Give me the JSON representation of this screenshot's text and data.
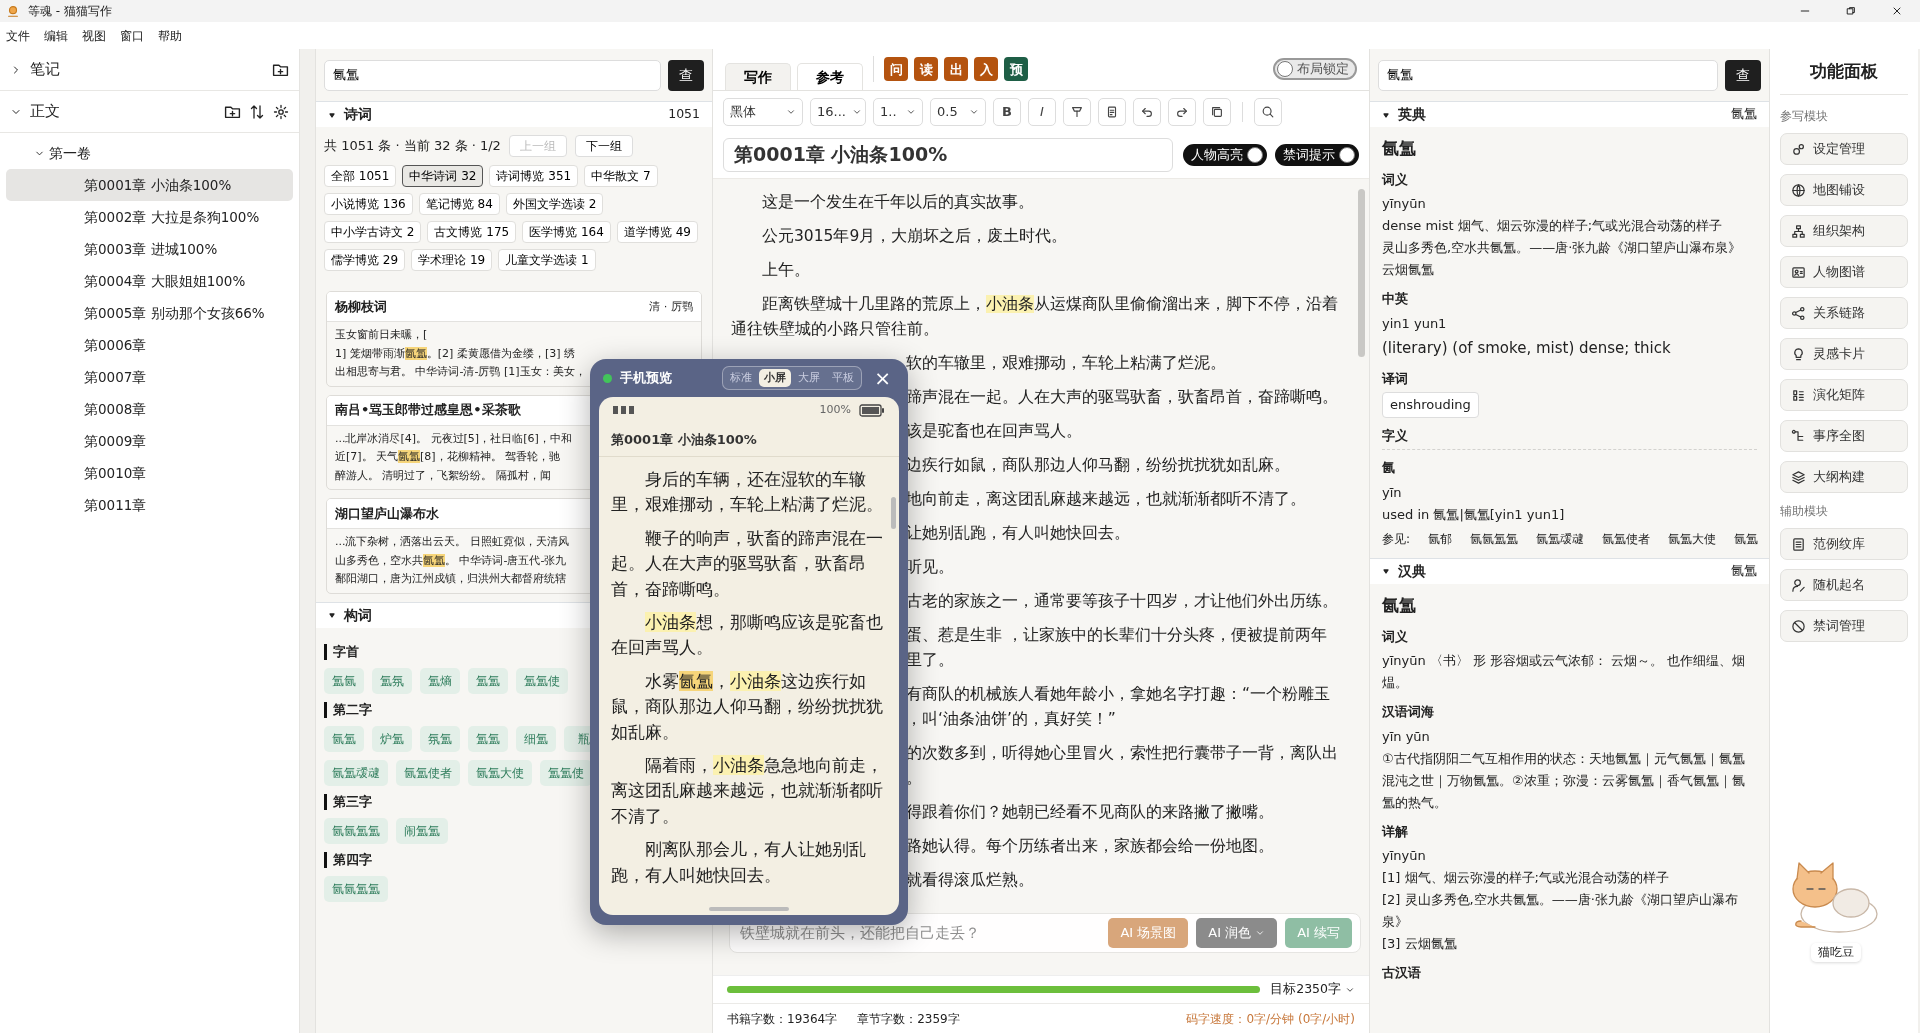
{
  "window": {
    "title": "等魂 - 猫猫写作"
  },
  "menu": [
    "文件",
    "编辑",
    "视图",
    "窗口",
    "帮助"
  ],
  "sidebar": {
    "sections": [
      {
        "label": "笔记",
        "expanded": false
      },
      {
        "label": "正文",
        "expanded": true,
        "children": [
          {
            "label": "第一卷",
            "expanded": true,
            "children": [
              {
                "label": "第0001章 小油条100%",
                "selected": true
              },
              {
                "label": "第0002章 大拉是条狗100%",
                "selected": false
              },
              {
                "label": "第0003章 进城100%",
                "selected": false
              },
              {
                "label": "第0004章 大眼姐姐100%",
                "selected": false
              },
              {
                "label": "第0005章 别动那个女孩66%",
                "selected": false
              },
              {
                "label": "第0006章",
                "selected": false
              },
              {
                "label": "第0007章",
                "selected": false
              },
              {
                "label": "第0008章",
                "selected": false
              },
              {
                "label": "第0009章",
                "selected": false
              },
              {
                "label": "第0010章",
                "selected": false
              },
              {
                "label": "第0011章",
                "selected": false
              }
            ]
          }
        ]
      }
    ]
  },
  "reference": {
    "search": {
      "value": "氤氲",
      "button": "查"
    },
    "poems": {
      "title": "诗词",
      "count": "1051",
      "expanded": true,
      "summary": "共 1051 条 · 当前 32 条 · 1/2",
      "pager": [
        {
          "label": "上一组",
          "disabled": true
        },
        {
          "label": "下一组",
          "disabled": false
        }
      ],
      "filters": [
        {
          "label": "全部 1051",
          "selected": false
        },
        {
          "label": "中华诗词 32",
          "selected": true
        },
        {
          "label": "诗词博览 351",
          "selected": false
        },
        {
          "label": "中华散文 7",
          "selected": false
        },
        {
          "label": "小说博览 136",
          "selected": false
        },
        {
          "label": "笔记博览 84",
          "selected": false
        },
        {
          "label": "外国文学选读 2",
          "selected": false
        },
        {
          "label": "中小学古诗文 2",
          "selected": false
        },
        {
          "label": "古文博览 175",
          "selected": false
        },
        {
          "label": "医学博览 164",
          "selected": false
        },
        {
          "label": "道学博览 49",
          "selected": false
        },
        {
          "label": "儒学博览 29",
          "selected": false
        },
        {
          "label": "学术理论 19",
          "selected": false
        },
        {
          "label": "儿童文学选读 1",
          "selected": false
        }
      ],
      "cards": [
        {
          "title": "杨柳枝词",
          "author": "清 · 厉鹗",
          "lines": [
            "玉女窗前日未曛，[",
            [
              {
                "text": "1] 笼烟带雨渐"
              },
              {
                "text": "氤氲",
                "kind": "term"
              },
              {
                "text": "。[2] 柔黄愿借为金缕，[3] 绣"
              }
            ],
            "出相思寄与君。 中华诗词-清-厉鹗 [1]玉女：美女，"
          ]
        },
        {
          "title": "南吕•骂玉郎带过感皇恩•采茶歌",
          "lines": [
            "...北岸冰消尽[4]。 元夜过[5]，社日临[6]，中和",
            [
              {
                "text": "近[7]。 天气"
              },
              {
                "text": "氤氲",
                "kind": "term"
              },
              {
                "text": "[8]，花柳精神。 驾香轮，驰"
              }
            ],
            "醉游人。 清明过了，飞絮纷纷。 隔孤村，闻"
          ]
        },
        {
          "title": "湖口望庐山瀑布水",
          "lines": [
            "...流下杂树，洒落出云天。 日照虹霓似，天清风",
            [
              {
                "text": "山多秀色，空水共"
              },
              {
                "text": "氤氲",
                "kind": "term"
              },
              {
                "text": "。 中华诗词-唐五代-张九"
              }
            ],
            "鄱阳湖口，唐为江州戍镇，归洪州大都督府统辖"
          ]
        }
      ]
    },
    "words": {
      "title": "构词",
      "expanded": true,
      "groups": [
        {
          "label": "字首",
          "chips": [
            "氲氤",
            "氲氛",
            "氲熵",
            "氲氲",
            "氲氲使"
          ]
        },
        {
          "label": "第二字",
          "chips": [
            "氤氲",
            "炉氲",
            "氛氲",
            "氲氲",
            "细氲",
            "瓶",
            "氤氲叆叇",
            "氤氲使者",
            "氤氲大使",
            "氲氲使"
          ]
        },
        {
          "label": "第三字",
          "chips": [
            "氤氤氲氲",
            "闹氲氲"
          ]
        },
        {
          "label": "第四字",
          "chips": [
            "氤氤氲氲"
          ]
        }
      ]
    }
  },
  "editor": {
    "tabs": [
      {
        "label": "写作",
        "selected": true
      },
      {
        "label": "参考",
        "selected": false
      }
    ],
    "actions": [
      {
        "label": "问",
        "color": "#b4530f"
      },
      {
        "label": "读",
        "color": "#b4530f"
      },
      {
        "label": "出",
        "color": "#b4530f"
      },
      {
        "label": "入",
        "color": "#b4530f"
      },
      {
        "label": "预",
        "color": "#1e5e46"
      }
    ],
    "layout_lock": {
      "label": "布局锁定",
      "on": false
    },
    "selects": [
      "黑体",
      "16...",
      "1..",
      "0.5"
    ],
    "format_buttons": [
      "B",
      "I"
    ],
    "title": "第0001章 小油条100%",
    "toggles": [
      {
        "label": "人物高亮",
        "on": true
      },
      {
        "label": "禁词提示",
        "on": true
      }
    ],
    "body": [
      {
        "kind": "para",
        "text": "这是一个发生在千年以后的真实故事。"
      },
      {
        "kind": "para",
        "text": "公元3015年9月，大崩坏之后，废土时代。"
      },
      {
        "kind": "para",
        "text": "上午。"
      },
      {
        "kind": "para",
        "text": [
          {
            "text": "距离铁壁城十几里路的荒原上，"
          },
          {
            "text": "小油条",
            "kind": "character"
          },
          {
            "text": "从运煤商队里偷偷溜出来，脚下不停，沿着通往铁壁城的小路只管往前。"
          }
        ]
      },
      {
        "kind": "clip",
        "lines": [
          "软的车辙里，艰难挪动，车轮上粘满了烂泥。"
        ]
      },
      {
        "kind": "clip",
        "lines": [
          "蹄声混在一起。人在大声的驱骂驮畜，驮畜昂首，奋蹄嘶鸣。"
        ]
      },
      {
        "kind": "clip",
        "lines": [
          "该是驼畜也在回声骂人。"
        ]
      },
      {
        "kind": "clip",
        "lines": [
          "边疾行如鼠，商队那边人仰马翻，纷纷扰扰犹如乱麻。"
        ]
      },
      {
        "kind": "clip",
        "lines": [
          "地向前走，离这团乱麻越来越远，也就渐渐都听不清了。"
        ]
      },
      {
        "kind": "clip",
        "lines": [
          "让她别乱跑，有人叫她快回去。"
        ]
      },
      {
        "kind": "clip",
        "lines": [
          "听见。"
        ]
      },
      {
        "kind": "clip",
        "lines": [
          "古老的家族之一，通常要等孩子十四岁，才让他们外出历练。"
        ]
      },
      {
        "kind": "clip",
        "lines": [
          "蛋、惹是生非 ，让家族中的长辈们十分头疼，便被提前两年",
          "里了。"
        ]
      },
      {
        "kind": "clip",
        "lines": [
          "有商队的机械族人看她年龄小，拿她名字打趣：“一个粉雕玉",
          "，叫‘油条油饼’的，真好笑！”"
        ]
      },
      {
        "kind": "clip",
        "lines": [
          "的次数多到，听得她心里冒火，索性把行囊带子一背，离队出",
          "。"
        ]
      },
      {
        "kind": "clip",
        "lines": [
          "得跟着你们？她朝已经看不见商队的来路撇了撇嘴。"
        ]
      },
      {
        "kind": "clip",
        "lines": [
          "路她认得。每个历练者出来，家族都会给一份地图。"
        ]
      },
      {
        "kind": "clip",
        "lines": [
          "就看得滚瓜烂熟。"
        ]
      }
    ],
    "ai_bar": {
      "placeholder": "铁壁城就在前头，还能把自己走丢？",
      "buttons": [
        {
          "label": "AI 场景图",
          "color": "#d8a67b",
          "dropdown": false
        },
        {
          "label": "AI 润色",
          "color": "#8b8b8b",
          "dropdown": true
        },
        {
          "label": "AI 续写",
          "color": "#8fbea4",
          "dropdown": false
        }
      ]
    },
    "progress": {
      "level": 1,
      "target": "目标2350字"
    },
    "status": {
      "book": "书籍字数：19364字",
      "chapter": "章节字数：2359字",
      "speed": "码字速度：0字/分钟 (0字/小时)"
    }
  },
  "phone_preview": {
    "title": "手机预览",
    "modes": [
      {
        "label": "标准",
        "selected": false
      },
      {
        "label": "小屏",
        "selected": true
      },
      {
        "label": "大屏",
        "selected": false
      },
      {
        "label": "平板",
        "selected": false
      }
    ],
    "close": "×",
    "battery": "100%",
    "chapter": "第0001章 小油条100%",
    "paragraphs": [
      "身后的车辆，还在湿软的车辙里，艰难挪动，车轮上粘满了烂泥。",
      "鞭子的响声，驮畜的蹄声混在一起。人在大声的驱骂驮畜，驮畜昂首，奋蹄嘶鸣。",
      [
        {
          "text": "小油条",
          "kind": "character"
        },
        {
          "text": "想，那嘶鸣应该是驼畜也在回声骂人。"
        }
      ],
      [
        {
          "text": "水雾"
        },
        {
          "text": "氤氲",
          "kind": "term"
        },
        {
          "text": "，"
        },
        {
          "text": "小油条",
          "kind": "character"
        },
        {
          "text": "这边疾行如鼠，商队那边人仰马翻，纷纷扰扰犹如乱麻。"
        }
      ],
      [
        {
          "text": "隔着雨，"
        },
        {
          "text": "小油条",
          "kind": "character"
        },
        {
          "text": "急急地向前走，离这团乱麻越来越远，也就渐渐都听不清了。"
        }
      ],
      "刚离队那会儿，有人让她别乱跑，有人叫她快回去。"
    ]
  },
  "dictionary": {
    "search": {
      "value": "氤氲",
      "button": "查"
    },
    "sections": [
      {
        "title": "英典",
        "word": "氤氲",
        "expanded": true,
        "entries": [
          {
            "kind": "word",
            "text": "氤氲"
          },
          {
            "kind": "label",
            "text": "词义"
          },
          {
            "kind": "text",
            "text": "yīnyūn"
          },
          {
            "kind": "text",
            "text": "dense mist 烟气、烟云弥漫的样子;气或光混合动荡的样子"
          },
          {
            "kind": "text",
            "text": "灵山多秀色,空水共氤氲。——唐·张九龄《湖口望庐山瀑布泉》"
          },
          {
            "kind": "text",
            "text": "云烟氤氲"
          },
          {
            "kind": "label",
            "text": "中英"
          },
          {
            "kind": "text",
            "text": "yin1 yun1"
          },
          {
            "kind": "big",
            "text": "(literary) (of smoke, mist) dense; thick"
          },
          {
            "kind": "label",
            "text": "译词"
          },
          {
            "kind": "tag",
            "text": "enshrouding"
          },
          {
            "kind": "rule-label",
            "text": "字义"
          },
          {
            "kind": "label",
            "text": "氤"
          },
          {
            "kind": "text",
            "text": "yīn"
          },
          {
            "kind": "text",
            "text": "used in 氤氲|氤氲[yin1 yun1]"
          },
          {
            "kind": "see",
            "text": "参见:",
            "links": [
              "氤郁",
              "氤氤氲氲",
              "氤氲叆叇",
              "氤氲使者",
              "氤氲大使",
              "氤氲"
            ]
          }
        ]
      },
      {
        "title": "汉典",
        "word": "氤氲",
        "expanded": true,
        "entries": [
          {
            "kind": "word",
            "text": "氤氲"
          },
          {
            "kind": "label",
            "text": "词义"
          },
          {
            "kind": "text",
            "text": "yīnyūn 〈书〉 形 形容烟或云气浓郁： 云烟～。 也作细缊、烟煴。"
          },
          {
            "kind": "label",
            "text": "汉语词海"
          },
          {
            "kind": "text",
            "text": "yīn yūn"
          },
          {
            "kind": "text",
            "text": "①古代指阴阳二气互相作用的状态：天地氤氲｜元气氤氲｜氤氲混沌之世｜万物氤氲。②浓重；弥漫：云雾氤氲｜香气氤氲｜氤氲的热气。"
          },
          {
            "kind": "label",
            "text": "详解"
          },
          {
            "kind": "text",
            "text": "yīnyūn"
          },
          {
            "kind": "text",
            "text": "[1] 烟气、烟云弥漫的样子;气或光混合动荡的样子"
          },
          {
            "kind": "text",
            "text": "[2] 灵山多秀色,空水共氤氲。——唐·张九龄《湖口望庐山瀑布泉》"
          },
          {
            "kind": "text",
            "text": "[3] 云烟氤氲"
          },
          {
            "kind": "label",
            "text": "古汉语"
          }
        ]
      }
    ]
  },
  "functions": {
    "title": "功能面板",
    "groups": [
      {
        "title": "参写模块",
        "items": [
          "设定管理",
          "地图铺设",
          "组织架构",
          "人物图谱",
          "关系链路",
          "灵感卡片",
          "演化矩阵",
          "事序全图",
          "大纲构建"
        ]
      },
      {
        "title": "辅助模块",
        "items": [
          "范例纹库",
          "随机起名",
          "禁词管理"
        ]
      }
    ],
    "mascot": {
      "label": "猫吃豆"
    }
  }
}
